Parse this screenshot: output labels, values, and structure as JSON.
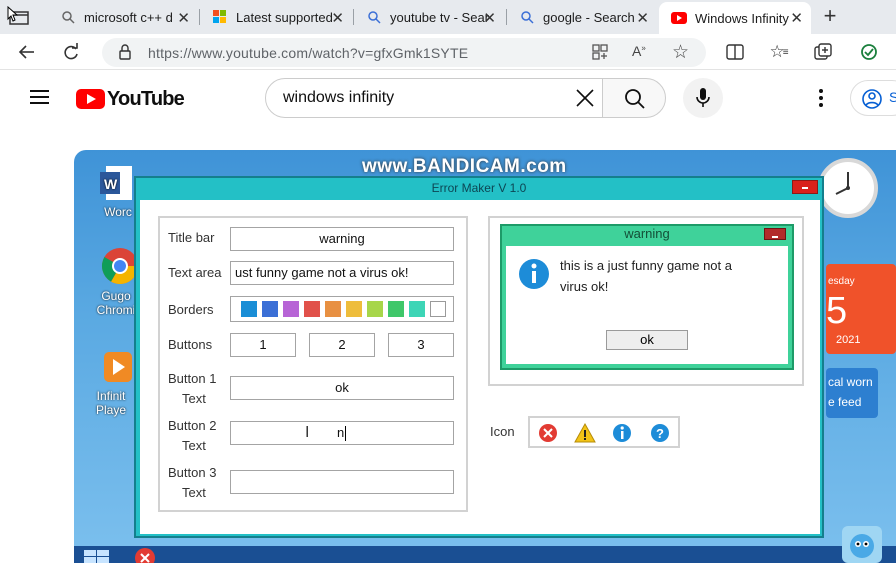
{
  "browser": {
    "tabs": [
      {
        "title": "microsoft c++ d",
        "icon": "search-icon"
      },
      {
        "title": "Latest supported",
        "icon": "microsoft-logo-icon"
      },
      {
        "title": "youtube tv - Sear",
        "icon": "search-icon"
      },
      {
        "title": "google - Search",
        "icon": "search-icon"
      },
      {
        "title": "Windows Infinity",
        "icon": "youtube-icon",
        "active": true
      }
    ],
    "url": "https://www.youtube.com/watch?v=gfxGmk1SYTE"
  },
  "youtube": {
    "logo_text": "YouTube",
    "search_value": "windows infinity",
    "signin_partial": "S"
  },
  "video": {
    "watermark": "www.BANDICAM.com",
    "desktop_icons": [
      "Worc",
      "Gugo Chromi",
      "Infinit Playe"
    ],
    "calendar": {
      "day_label": "esday",
      "day_number": "5",
      "year": "2021"
    },
    "widget_lines": [
      "cal worn",
      "e feed"
    ],
    "error_maker": {
      "window_title": "Error Maker V 1.0",
      "fields": {
        "title_bar_label": "Title bar",
        "title_bar_value": "warning",
        "text_area_label": "Text area",
        "text_area_value": "ust funny game not a virus ok!",
        "borders_label": "Borders",
        "buttons_label": "Buttons",
        "button_options": [
          "1",
          "2",
          "3"
        ],
        "button1_label": "Button 1",
        "button1_label2": "Text",
        "button1_value": "ok",
        "button2_label": "Button 2",
        "button2_label2": "Text",
        "button2_value": "n",
        "button3_label": "Button 3",
        "button3_label2": "Text",
        "button3_value": ""
      },
      "border_colors": [
        "#1a8ed6",
        "#3b6fd6",
        "#b764d6",
        "#e1514a",
        "#e89042",
        "#eebd3b",
        "#a7d64a",
        "#3fc76a",
        "#3dd5b6",
        "#ffffff"
      ],
      "preview": {
        "title": "warning",
        "message_line1": "this is a just funny game not a",
        "message_line2": "virus ok!",
        "button": "ok"
      },
      "icon_label": "Icon",
      "icon_options": [
        "error-icon",
        "warning-icon",
        "info-icon",
        "question-icon"
      ]
    }
  }
}
